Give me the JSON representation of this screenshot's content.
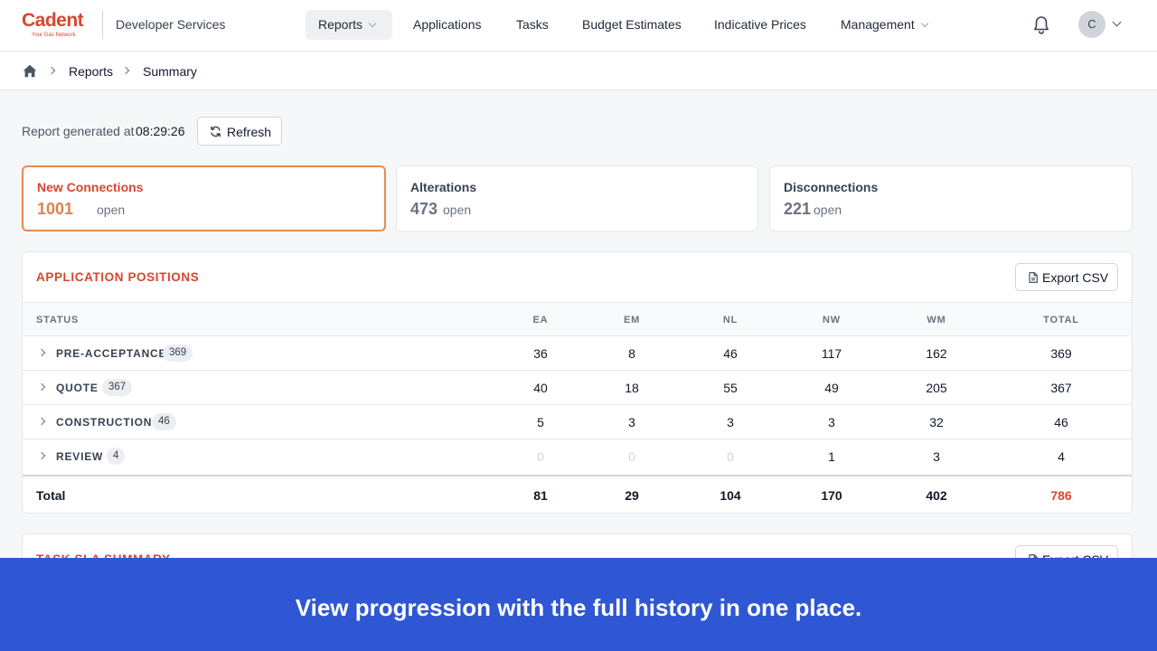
{
  "header": {
    "logo_text": "Cadent",
    "logo_tagline": "Your Gas Network",
    "app_name": "Developer Services",
    "nav": [
      "Reports",
      "Applications",
      "Tasks",
      "Budget Estimates",
      "Indicative Prices",
      "Management"
    ],
    "avatar_initial": "C"
  },
  "breadcrumb": [
    "Reports",
    "Summary"
  ],
  "report": {
    "generated_label": "Report generated at",
    "generated_time": "08:29:26",
    "refresh_label": "Refresh"
  },
  "cards": [
    {
      "title": "New Connections",
      "count": "1001",
      "suffix": "open"
    },
    {
      "title": "Alterations",
      "count": "473",
      "suffix": "open"
    },
    {
      "title": "Disconnections",
      "count": "221",
      "suffix": "open"
    }
  ],
  "positions": {
    "title": "APPLICATION POSITIONS",
    "export_label": "Export CSV",
    "columns": [
      "STATUS",
      "EA",
      "EM",
      "NL",
      "NW",
      "WM",
      "TOTAL"
    ],
    "rows": [
      {
        "status": "PRE-ACCEPTANCE",
        "badge": "369",
        "values": [
          "36",
          "8",
          "46",
          "117",
          "162",
          "369"
        ]
      },
      {
        "status": "QUOTE",
        "badge": "367",
        "values": [
          "40",
          "18",
          "55",
          "49",
          "205",
          "367"
        ]
      },
      {
        "status": "CONSTRUCTION",
        "badge": "46",
        "values": [
          "5",
          "3",
          "3",
          "3",
          "32",
          "46"
        ]
      },
      {
        "status": "REVIEW",
        "badge": "4",
        "values": [
          "0",
          "0",
          "0",
          "1",
          "3",
          "4"
        ]
      }
    ],
    "total": {
      "label": "Total",
      "values": [
        "81",
        "29",
        "104",
        "170",
        "402",
        "786"
      ]
    }
  },
  "sla": {
    "title": "TASK SLA SUMMARY",
    "export_label": "Export CSV"
  },
  "banner": {
    "text": "View progression with the full history in one place."
  },
  "colors": {
    "brand": "#d8462f",
    "active_card_border": "#e58a54",
    "banner": "#2f57d3"
  }
}
